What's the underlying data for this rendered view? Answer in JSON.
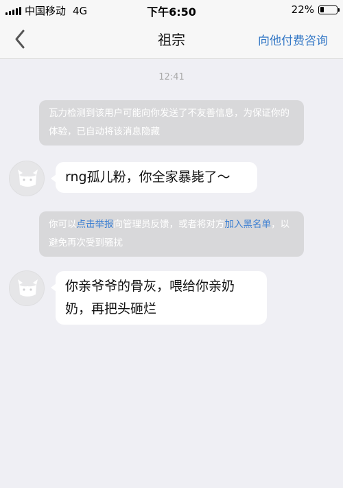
{
  "status_bar": {
    "carrier": "中国移动",
    "network": "4G",
    "time": "下午6:50",
    "battery": "22%",
    "battery_level": 0.22
  },
  "nav": {
    "title": "祖宗",
    "action": "向他付费咨询"
  },
  "chat": {
    "timestamp": "12:41",
    "system_notice_1": "瓦力检测到该用户可能向你发送了不友善信息，为保证你的体验，已自动将该消息隐藏",
    "messages": [
      {
        "text": "rng孤儿粉，你全家暴毙了～"
      },
      {
        "text": "你亲爷爷的骨灰，喂给你亲奶奶，再把头砸烂"
      }
    ],
    "system_notice_2": {
      "prefix": "你可以",
      "report_link": "点击举报",
      "middle": "向管理员反馈，或者将对方",
      "blacklist_link": "加入黑名单",
      "suffix": "，以避免再次受到骚扰"
    }
  }
}
